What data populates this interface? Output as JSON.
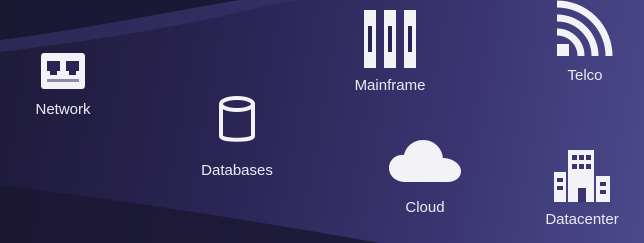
{
  "items": [
    {
      "id": "network",
      "label": "Network",
      "icon": "network-switch-icon"
    },
    {
      "id": "databases",
      "label": "Databases",
      "icon": "database-icon"
    },
    {
      "id": "mainframe",
      "label": "Mainframe",
      "icon": "mainframe-icon"
    },
    {
      "id": "cloud",
      "label": "Cloud",
      "icon": "cloud-icon"
    },
    {
      "id": "telco",
      "label": "Telco",
      "icon": "wireless-signal-icon"
    },
    {
      "id": "datacenter",
      "label": "Datacenter",
      "icon": "buildings-icon"
    }
  ],
  "colors": {
    "background_dark": "#1e1a39",
    "background_light": "#4a4a8a",
    "icon": "#f2f2f7",
    "text": "#e9e9f2"
  }
}
